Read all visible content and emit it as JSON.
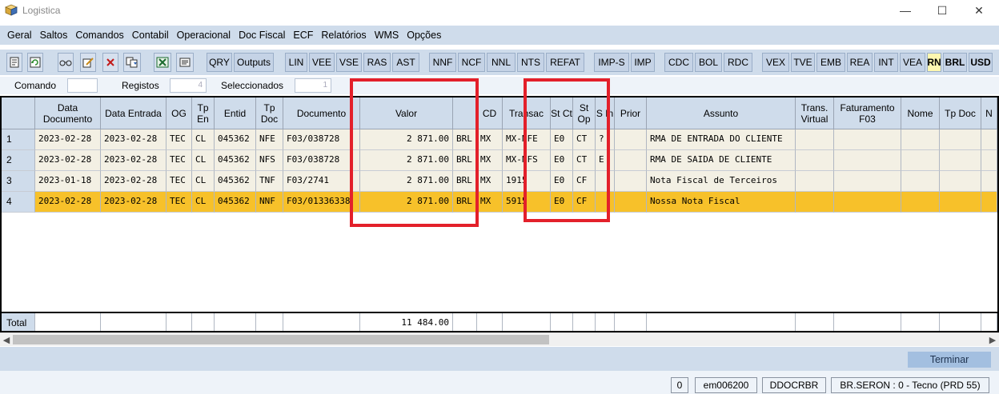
{
  "window": {
    "title": "Logistica",
    "minimize": "—",
    "maximize": "☐",
    "close": "✕"
  },
  "menu": [
    "Geral",
    "Saltos",
    "Comandos",
    "Contabil",
    "Operacional",
    "Doc Fiscal",
    "ECF",
    "Relatórios",
    "WMS",
    "Opções"
  ],
  "toolbar": {
    "icons": [
      "document-icon",
      "refresh-icon",
      "glasses-icon",
      "edit-icon",
      "delete-icon",
      "copy-icon",
      "excel-icon",
      "print-icon"
    ],
    "buttons": [
      "QRY",
      "Outputs",
      "LIN",
      "VEE",
      "VSE",
      "RAS",
      "AST",
      "NNF",
      "NCF",
      "NNL",
      "NTS",
      "REFAT",
      "IMP-S",
      "IMP",
      "CDC",
      "BOL",
      "RDC",
      "VEX",
      "TVE",
      "EMB",
      "REA",
      "INT",
      "VEA",
      "RN",
      "BRL",
      "USD"
    ]
  },
  "filters": {
    "comando_label": "Comando",
    "comando_value": "",
    "registos_label": "Registos",
    "registos_value": "4",
    "seleccionados_label": "Seleccionados",
    "seleccionados_value": "1"
  },
  "grid": {
    "columns": [
      "",
      "Data Documento",
      "Data Entrada",
      "OG",
      "Tp En",
      "Entid",
      "Tp Doc",
      "Documento",
      "Valor",
      "",
      "CD",
      "Transac",
      "St Ct",
      "St Op",
      "S In",
      "Prior",
      "Assunto",
      "Trans. Virtual",
      "Faturamento F03",
      "Nome",
      "Tp Doc",
      "N"
    ],
    "rows": [
      [
        "1",
        "2023-02-28",
        "2023-02-28",
        "TEC",
        "CL",
        "045362",
        "NFE",
        "F03/038728",
        "2 871.00",
        "BRL",
        "MX",
        "MX-NFE",
        "E0",
        "CT",
        "?",
        "",
        "RMA DE ENTRADA DO CLIENTE",
        "",
        "",
        "",
        "",
        ""
      ],
      [
        "2",
        "2023-02-28",
        "2023-02-28",
        "TEC",
        "CL",
        "045362",
        "NFS",
        "F03/038728",
        "2 871.00",
        "BRL",
        "MX",
        "MX-NFS",
        "E0",
        "CT",
        "E",
        "",
        "RMA DE SAIDA DE CLIENTE",
        "",
        "",
        "",
        "",
        ""
      ],
      [
        "3",
        "2023-01-18",
        "2023-02-28",
        "TEC",
        "CL",
        "045362",
        "TNF",
        "F03/2741",
        "2 871.00",
        "BRL",
        "MX",
        "1915",
        "E0",
        "CF",
        "",
        "",
        "Nota Fiscal de Terceiros",
        "",
        "",
        "",
        "",
        ""
      ],
      [
        "4",
        "2023-02-28",
        "2023-02-28",
        "TEC",
        "CL",
        "045362",
        "NNF",
        "F03/01336338",
        "2 871.00",
        "BRL",
        "MX",
        "5915",
        "E0",
        "CF",
        "",
        "",
        "Nossa Nota Fiscal",
        "",
        "",
        "",
        "",
        ""
      ]
    ],
    "selected_row": 3,
    "total_label": "Total",
    "total_value": "11 484.00"
  },
  "bottom": {
    "terminar": "Terminar"
  },
  "status": [
    "0",
    "em006200",
    "DDOCRBR",
    "BR.SERON : 0 - Tecno (PRD 55)"
  ],
  "colors": {
    "header_bg": "#cfdceb",
    "row_bg": "#f3f0e4",
    "selected_bg": "#f7c12a",
    "highlight_border": "#e3202a"
  }
}
